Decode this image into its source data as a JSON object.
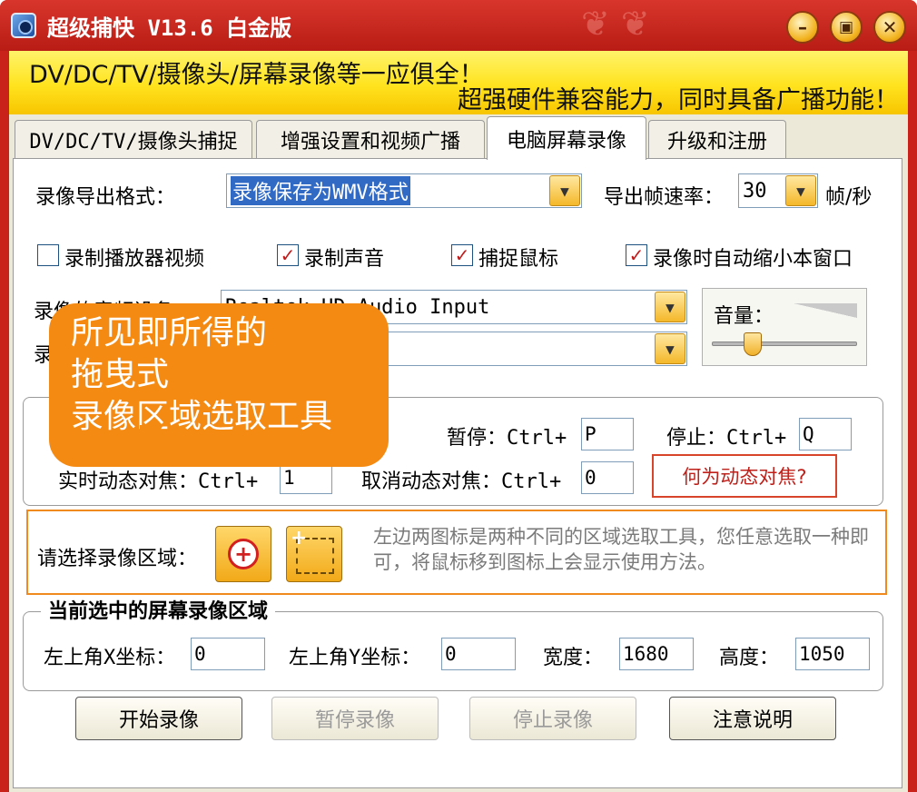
{
  "window": {
    "title": "超级捕快 V13.6 白金版"
  },
  "banner": {
    "line1": "DV/DC/TV/摄像头/屏幕录像等一应俱全！",
    "line2": "超强硬件兼容能力，同时具备广播功能！"
  },
  "tabs": [
    {
      "label": "DV/DC/TV/摄像头捕捉"
    },
    {
      "label": "增强设置和视频广播"
    },
    {
      "label": "电脑屏幕录像"
    },
    {
      "label": "升级和注册"
    }
  ],
  "format": {
    "label": "录像导出格式：",
    "value": "录像保存为WMV格式"
  },
  "fps": {
    "label": "导出帧速率：",
    "value": "30",
    "unit": "帧/秒"
  },
  "checks": [
    {
      "label": "录制播放器视频",
      "checked": false
    },
    {
      "label": "录制声音",
      "checked": true
    },
    {
      "label": "捕捉鼠标",
      "checked": true
    },
    {
      "label": "录像时自动缩小本窗口",
      "checked": true
    }
  ],
  "audio": {
    "device_label": "录像的音频设备：",
    "device_value": "Realtek HD Audio Input",
    "input_label": "录",
    "input_value": ""
  },
  "volume": {
    "label": "音量：",
    "level": 0.25
  },
  "callout": {
    "line1": "所见即所得的",
    "line2": "拖曳式",
    "line3": "录像区域选取工具"
  },
  "hotkeys": {
    "pause_label": "暂停：Ctrl+",
    "pause_value": "P",
    "stop_label": "停止：Ctrl+",
    "stop_value": "Q",
    "focus_label": "实时动态对焦：Ctrl+",
    "focus_value": "1",
    "cancel_label": "取消动态对焦：Ctrl+",
    "cancel_value": "0",
    "help_link": "何为动态对焦?"
  },
  "region": {
    "label": "请选择录像区域：",
    "hint": "左边两图标是两种不同的区域选取工具，您任意选取一种即可，将鼠标移到图标上会显示使用方法。"
  },
  "current": {
    "title": "当前选中的屏幕录像区域",
    "x_label": "左上角X坐标：",
    "x_value": "0",
    "y_label": "左上角Y坐标：",
    "y_value": "0",
    "w_label": "宽度：",
    "w_value": "1680",
    "h_label": "高度：",
    "h_value": "1050"
  },
  "buttons": {
    "start": "开始录像",
    "pause": "暂停录像",
    "stop": "停止录像",
    "notes": "注意说明"
  }
}
